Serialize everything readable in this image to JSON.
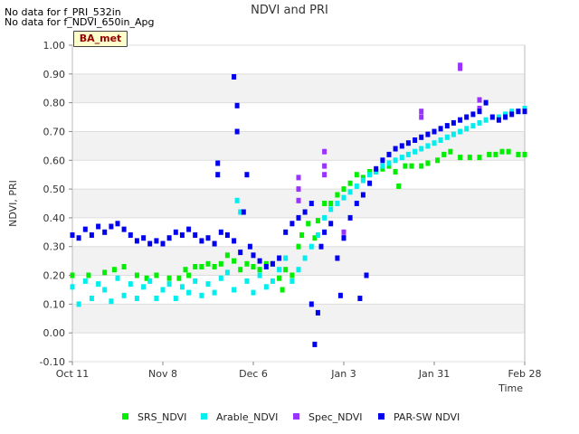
{
  "notices": [
    "No data for f_PRI_532in",
    "No data for f_NDVI_650in_Apg"
  ],
  "badge": "BA_met",
  "chart_data": {
    "type": "scatter",
    "title": "NDVI and PRI",
    "xlabel": "Time",
    "ylabel": "NDVI, PRI",
    "x_ticks": [
      "Oct 11",
      "Nov 8",
      "Dec 6",
      "Jan 3",
      "Jan 31",
      "Feb 28"
    ],
    "x_range_days": [
      0,
      140
    ],
    "y_ticks": [
      "-0.10",
      "0.00",
      "0.10",
      "0.20",
      "0.30",
      "0.40",
      "0.50",
      "0.60",
      "0.70",
      "0.80",
      "0.90",
      "1.00"
    ],
    "ylim": [
      -0.1,
      1.0
    ],
    "grid": "horizontal bands",
    "legend_position": "bottom",
    "series": [
      {
        "name": "SRS_NDVI",
        "color": "#00ee00",
        "points": [
          [
            0,
            0.2
          ],
          [
            5,
            0.2
          ],
          [
            10,
            0.21
          ],
          [
            13,
            0.22
          ],
          [
            16,
            0.23
          ],
          [
            20,
            0.2
          ],
          [
            23,
            0.19
          ],
          [
            26,
            0.2
          ],
          [
            30,
            0.19
          ],
          [
            33,
            0.19
          ],
          [
            35,
            0.22
          ],
          [
            36,
            0.2
          ],
          [
            38,
            0.23
          ],
          [
            40,
            0.23
          ],
          [
            42,
            0.24
          ],
          [
            44,
            0.23
          ],
          [
            46,
            0.24
          ],
          [
            48,
            0.27
          ],
          [
            50,
            0.25
          ],
          [
            52,
            0.22
          ],
          [
            54,
            0.24
          ],
          [
            56,
            0.23
          ],
          [
            58,
            0.22
          ],
          [
            60,
            0.24
          ],
          [
            62,
            0.24
          ],
          [
            64,
            0.19
          ],
          [
            65,
            0.15
          ],
          [
            66,
            0.22
          ],
          [
            68,
            0.2
          ],
          [
            70,
            0.3
          ],
          [
            71,
            0.34
          ],
          [
            73,
            0.38
          ],
          [
            75,
            0.33
          ],
          [
            76,
            0.39
          ],
          [
            78,
            0.45
          ],
          [
            80,
            0.45
          ],
          [
            82,
            0.48
          ],
          [
            84,
            0.5
          ],
          [
            86,
            0.52
          ],
          [
            88,
            0.55
          ],
          [
            90,
            0.54
          ],
          [
            92,
            0.56
          ],
          [
            94,
            0.56
          ],
          [
            96,
            0.57
          ],
          [
            98,
            0.58
          ],
          [
            100,
            0.56
          ],
          [
            101,
            0.51
          ],
          [
            103,
            0.58
          ],
          [
            105,
            0.58
          ],
          [
            108,
            0.58
          ],
          [
            110,
            0.59
          ],
          [
            113,
            0.6
          ],
          [
            115,
            0.62
          ],
          [
            117,
            0.63
          ],
          [
            120,
            0.61
          ],
          [
            123,
            0.61
          ],
          [
            126,
            0.61
          ],
          [
            129,
            0.62
          ],
          [
            131,
            0.62
          ],
          [
            133,
            0.63
          ],
          [
            135,
            0.63
          ],
          [
            138,
            0.62
          ],
          [
            140,
            0.62
          ]
        ]
      },
      {
        "name": "Arable_NDVI",
        "color": "#00eeee",
        "points": [
          [
            0,
            0.16
          ],
          [
            2,
            0.1
          ],
          [
            4,
            0.18
          ],
          [
            6,
            0.12
          ],
          [
            8,
            0.17
          ],
          [
            10,
            0.15
          ],
          [
            12,
            0.11
          ],
          [
            14,
            0.19
          ],
          [
            16,
            0.13
          ],
          [
            18,
            0.17
          ],
          [
            20,
            0.12
          ],
          [
            22,
            0.16
          ],
          [
            24,
            0.18
          ],
          [
            26,
            0.12
          ],
          [
            28,
            0.15
          ],
          [
            30,
            0.17
          ],
          [
            32,
            0.12
          ],
          [
            34,
            0.16
          ],
          [
            36,
            0.14
          ],
          [
            38,
            0.18
          ],
          [
            40,
            0.13
          ],
          [
            42,
            0.17
          ],
          [
            44,
            0.14
          ],
          [
            46,
            0.19
          ],
          [
            48,
            0.21
          ],
          [
            50,
            0.15
          ],
          [
            51,
            0.46
          ],
          [
            52,
            0.42
          ],
          [
            54,
            0.18
          ],
          [
            56,
            0.14
          ],
          [
            58,
            0.2
          ],
          [
            60,
            0.16
          ],
          [
            62,
            0.18
          ],
          [
            64,
            0.22
          ],
          [
            66,
            0.26
          ],
          [
            68,
            0.18
          ],
          [
            70,
            0.22
          ],
          [
            72,
            0.26
          ],
          [
            74,
            0.3
          ],
          [
            76,
            0.34
          ],
          [
            78,
            0.4
          ],
          [
            80,
            0.43
          ],
          [
            82,
            0.45
          ],
          [
            84,
            0.47
          ],
          [
            86,
            0.49
          ],
          [
            88,
            0.51
          ],
          [
            90,
            0.53
          ],
          [
            92,
            0.55
          ],
          [
            94,
            0.56
          ],
          [
            96,
            0.58
          ],
          [
            98,
            0.59
          ],
          [
            100,
            0.6
          ],
          [
            102,
            0.61
          ],
          [
            104,
            0.62
          ],
          [
            106,
            0.63
          ],
          [
            108,
            0.64
          ],
          [
            110,
            0.65
          ],
          [
            112,
            0.66
          ],
          [
            114,
            0.67
          ],
          [
            116,
            0.68
          ],
          [
            118,
            0.69
          ],
          [
            120,
            0.7
          ],
          [
            122,
            0.71
          ],
          [
            124,
            0.72
          ],
          [
            126,
            0.73
          ],
          [
            128,
            0.74
          ],
          [
            130,
            0.75
          ],
          [
            132,
            0.75
          ],
          [
            134,
            0.76
          ],
          [
            136,
            0.77
          ],
          [
            138,
            0.77
          ],
          [
            140,
            0.78
          ]
        ]
      },
      {
        "name": "Spec_NDVI",
        "color": "#9933ff",
        "points": [
          [
            70,
            0.54
          ],
          [
            70,
            0.5
          ],
          [
            70,
            0.46
          ],
          [
            78,
            0.63
          ],
          [
            78,
            0.58
          ],
          [
            78,
            0.55
          ],
          [
            84,
            0.35
          ],
          [
            84,
            0.33
          ],
          [
            108,
            0.77
          ],
          [
            108,
            0.75
          ],
          [
            126,
            0.81
          ],
          [
            126,
            0.78
          ],
          [
            120,
            0.93
          ],
          [
            120,
            0.92
          ]
        ]
      },
      {
        "name": "PAR-SW NDVI",
        "color": "#0000ee",
        "points": [
          [
            0,
            0.34
          ],
          [
            2,
            0.33
          ],
          [
            4,
            0.36
          ],
          [
            6,
            0.34
          ],
          [
            8,
            0.37
          ],
          [
            10,
            0.35
          ],
          [
            12,
            0.37
          ],
          [
            14,
            0.38
          ],
          [
            16,
            0.36
          ],
          [
            18,
            0.34
          ],
          [
            20,
            0.32
          ],
          [
            22,
            0.33
          ],
          [
            24,
            0.31
          ],
          [
            26,
            0.32
          ],
          [
            28,
            0.31
          ],
          [
            30,
            0.33
          ],
          [
            32,
            0.35
          ],
          [
            34,
            0.34
          ],
          [
            36,
            0.36
          ],
          [
            38,
            0.34
          ],
          [
            40,
            0.32
          ],
          [
            42,
            0.33
          ],
          [
            44,
            0.31
          ],
          [
            45,
            0.55
          ],
          [
            45,
            0.59
          ],
          [
            46,
            0.35
          ],
          [
            48,
            0.34
          ],
          [
            50,
            0.32
          ],
          [
            50,
            0.89
          ],
          [
            51,
            0.79
          ],
          [
            51,
            0.7
          ],
          [
            52,
            0.28
          ],
          [
            53,
            0.42
          ],
          [
            54,
            0.55
          ],
          [
            55,
            0.3
          ],
          [
            56,
            0.27
          ],
          [
            58,
            0.25
          ],
          [
            60,
            0.23
          ],
          [
            62,
            0.24
          ],
          [
            64,
            0.26
          ],
          [
            66,
            0.35
          ],
          [
            68,
            0.38
          ],
          [
            70,
            0.4
          ],
          [
            72,
            0.42
          ],
          [
            74,
            0.45
          ],
          [
            74,
            0.1
          ],
          [
            75,
            -0.04
          ],
          [
            76,
            0.07
          ],
          [
            77,
            0.3
          ],
          [
            78,
            0.35
          ],
          [
            80,
            0.38
          ],
          [
            82,
            0.26
          ],
          [
            83,
            0.13
          ],
          [
            84,
            0.33
          ],
          [
            86,
            0.4
          ],
          [
            88,
            0.45
          ],
          [
            89,
            0.12
          ],
          [
            90,
            0.48
          ],
          [
            91,
            0.2
          ],
          [
            92,
            0.52
          ],
          [
            94,
            0.57
          ],
          [
            96,
            0.6
          ],
          [
            98,
            0.62
          ],
          [
            100,
            0.64
          ],
          [
            102,
            0.65
          ],
          [
            104,
            0.66
          ],
          [
            106,
            0.67
          ],
          [
            108,
            0.68
          ],
          [
            110,
            0.69
          ],
          [
            112,
            0.7
          ],
          [
            114,
            0.71
          ],
          [
            116,
            0.72
          ],
          [
            118,
            0.73
          ],
          [
            120,
            0.74
          ],
          [
            122,
            0.75
          ],
          [
            124,
            0.76
          ],
          [
            126,
            0.77
          ],
          [
            128,
            0.8
          ],
          [
            130,
            0.75
          ],
          [
            132,
            0.74
          ],
          [
            134,
            0.75
          ],
          [
            136,
            0.76
          ],
          [
            138,
            0.77
          ],
          [
            140,
            0.77
          ]
        ]
      }
    ]
  }
}
